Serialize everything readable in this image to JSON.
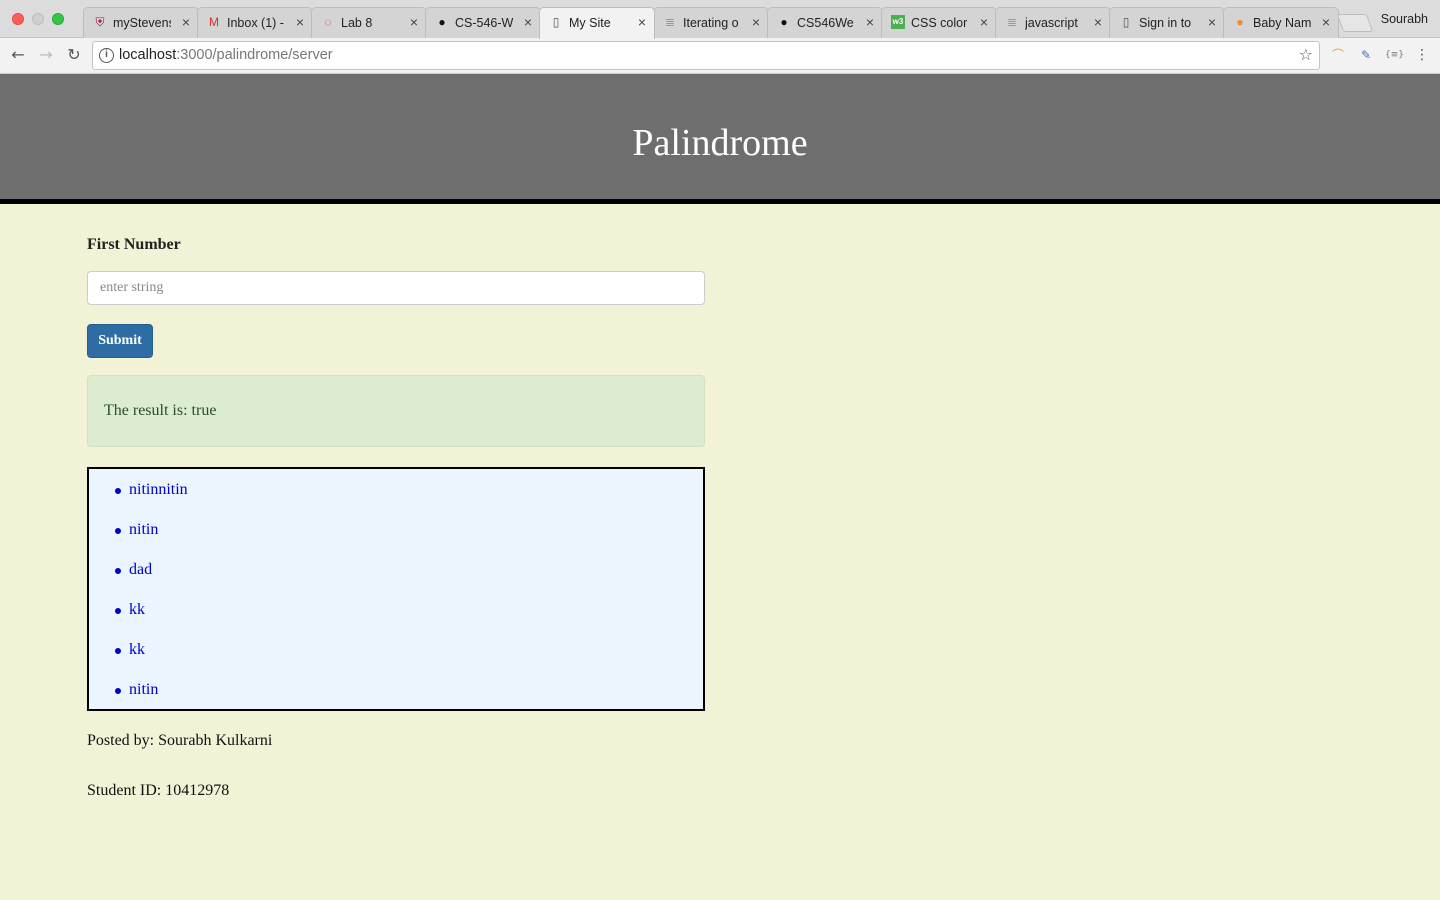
{
  "browser": {
    "tabs": [
      {
        "title": "myStevens",
        "icon": "stevens-icon",
        "glyph": "⛨",
        "color": "#a3193b"
      },
      {
        "title": "Inbox (1) -",
        "icon": "gmail-icon",
        "glyph": "M",
        "color": "#d93025"
      },
      {
        "title": "Lab 8",
        "icon": "canvas-icon",
        "glyph": "◌",
        "color": "#e03a3e"
      },
      {
        "title": "CS-546-W",
        "icon": "github-icon",
        "glyph": "●",
        "color": "#111111"
      },
      {
        "title": "My Site",
        "icon": "page-icon",
        "glyph": "▯",
        "color": "#555555"
      },
      {
        "title": "Iterating o",
        "icon": "stackoverflow-icon",
        "glyph": "≣",
        "color": "#f48024"
      },
      {
        "title": "CS546We",
        "icon": "github-icon",
        "glyph": "●",
        "color": "#111111"
      },
      {
        "title": "CSS color",
        "icon": "w3schools-icon",
        "glyph": "w3",
        "color": "#4caf50"
      },
      {
        "title": "javascript",
        "icon": "stackoverflow-icon",
        "glyph": "≣",
        "color": "#f48024"
      },
      {
        "title": "Sign in to",
        "icon": "page-icon",
        "glyph": "▯",
        "color": "#555555"
      },
      {
        "title": "Baby Nam",
        "icon": "baby-names-icon",
        "glyph": "●",
        "color": "#f08a24"
      }
    ],
    "profile": "Sourabh",
    "url_host": "localhost",
    "url_path": ":3000/palindrome/server"
  },
  "header": {
    "title": "Palindrome"
  },
  "form": {
    "label": "First Number",
    "placeholder": "enter string",
    "value": "",
    "submit_label": "Submit"
  },
  "result": {
    "text": "The result is: true"
  },
  "history": {
    "items": [
      "nitinnitin",
      "nitin",
      "dad",
      "kk",
      "kk",
      "nitin"
    ]
  },
  "footer": {
    "posted_by": "Posted by: Sourabh Kulkarni",
    "student_id": "Student ID: 10412978"
  }
}
